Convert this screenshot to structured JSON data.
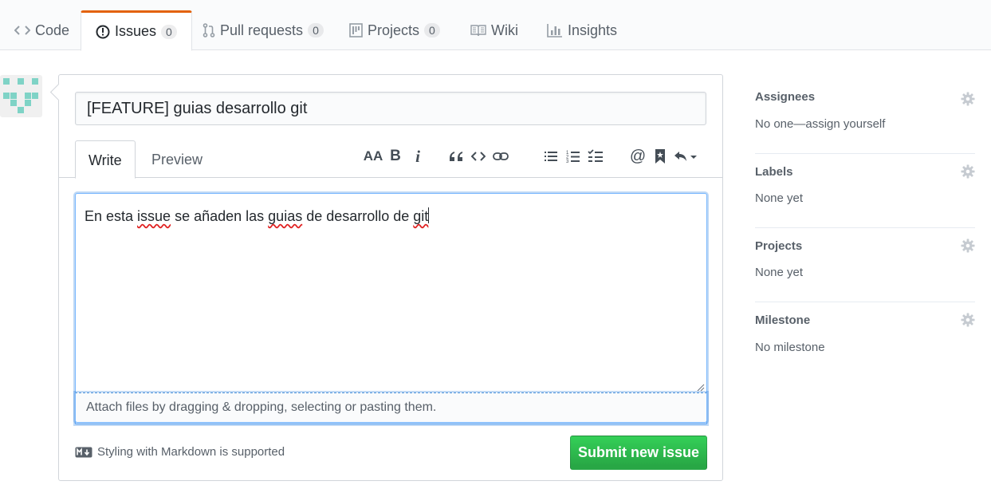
{
  "nav": {
    "code": "Code",
    "issues": "Issues",
    "issues_count": "0",
    "pulls": "Pull requests",
    "pulls_count": "0",
    "projects": "Projects",
    "projects_count": "0",
    "wiki": "Wiki",
    "insights": "Insights"
  },
  "issue": {
    "title": "[FEATURE] guias desarrollo git",
    "tab_write": "Write",
    "tab_preview": "Preview",
    "body_parts": [
      "En esta ",
      "issue",
      " se añaden las ",
      "guias",
      " de desarrollo de ",
      "git"
    ],
    "attach_hint": "Attach files by dragging & dropping, selecting or pasting them.",
    "markdown_hint": "Styling with Markdown is supported",
    "submit": "Submit new issue",
    "toolbar_header_text": "AA",
    "toolbar_bold_text": "B",
    "toolbar_italic_text": "i",
    "toolbar_mention_text": "@"
  },
  "sidebar": {
    "assignees": {
      "heading": "Assignees",
      "value": "No one—assign yourself"
    },
    "labels": {
      "heading": "Labels",
      "value": "None yet"
    },
    "projects": {
      "heading": "Projects",
      "value": "None yet"
    },
    "milestone": {
      "heading": "Milestone",
      "value": "No milestone"
    }
  },
  "colors": {
    "accent_tab": "#e36209",
    "submit_green": "#28a745",
    "focus_blue": "#79b8ff",
    "avatar": "#7fd3c6"
  },
  "icons": [
    "code-icon",
    "issue-icon",
    "pull-request-icon",
    "project-icon",
    "wiki-icon",
    "graph-icon",
    "text-size-icon",
    "bold-icon",
    "italic-icon",
    "quote-icon",
    "code-brackets-icon",
    "link-icon",
    "unordered-list-icon",
    "ordered-list-icon",
    "task-list-icon",
    "mention-icon",
    "bookmark-icon",
    "reply-icon",
    "markdown-icon",
    "gear-icon"
  ]
}
